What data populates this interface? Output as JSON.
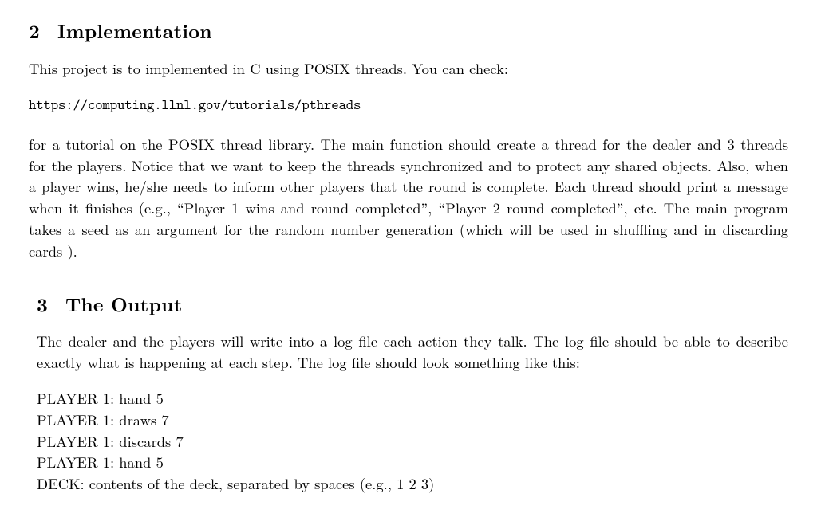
{
  "section2": {
    "number": "2",
    "title": "Implementation",
    "para1": "This project is to implemented in C using POSIX threads. You can check:",
    "url": "https://computing.llnl.gov/tutorials/pthreads",
    "para2": "for a tutorial on the POSIX thread library. The main function should create a thread for the dealer and 3 threads for the players. Notice that we want to keep the threads synchronized and to protect any shared objects. Also, when a player wins, he/she needs to inform other players that the round is complete. Each thread should print a message when it finishes (e.g., “Player 1 wins and round completed”, “Player 2 round completed”, etc. The main program takes a seed as an argument for the random number generation (which will be used in shuffling and in discarding cards )."
  },
  "section3": {
    "number": "3",
    "title": "The Output",
    "para1": "The dealer and the players will write into a log file each action they talk. The log file should be able to describe exactly what is happening at each step. The log file should look something like this:",
    "log": [
      "PLAYER 1: hand 5",
      "PLAYER 1: draws 7",
      "PLAYER 1: discards 7",
      "PLAYER 1: hand 5",
      "DECK: contents of the deck, separated by spaces (e.g., 1 2 3)"
    ]
  }
}
